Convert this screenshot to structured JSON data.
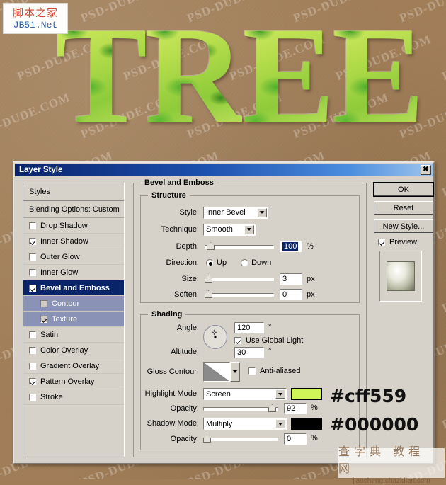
{
  "artwork": {
    "word_letters": [
      "T",
      "R",
      "E",
      "E"
    ],
    "background_color": "#a07d57",
    "watermark_text": "PSD-DUDE.COM"
  },
  "logo": {
    "cn": "脚本之家",
    "en": "JB51.Net"
  },
  "footer_watermark": {
    "cn": "查字典 教程 网",
    "url": "jiaocheng.chazidian.com"
  },
  "dialog": {
    "title": "Layer Style",
    "close_label": "✖"
  },
  "styles_panel": {
    "header": "Styles",
    "blending_options": "Blending Options: Custom",
    "effects": [
      {
        "label": "Drop Shadow",
        "checked": false,
        "selected": false,
        "indent": false
      },
      {
        "label": "Inner Shadow",
        "checked": true,
        "selected": false,
        "indent": false
      },
      {
        "label": "Outer Glow",
        "checked": false,
        "selected": false,
        "indent": false
      },
      {
        "label": "Inner Glow",
        "checked": false,
        "selected": false,
        "indent": false
      },
      {
        "label": "Bevel and Emboss",
        "checked": true,
        "selected": true,
        "indent": false
      },
      {
        "label": "Contour",
        "checked": false,
        "selected": "sub",
        "indent": true
      },
      {
        "label": "Texture",
        "checked": true,
        "selected": "sub",
        "indent": true
      },
      {
        "label": "Satin",
        "checked": false,
        "selected": false,
        "indent": false
      },
      {
        "label": "Color Overlay",
        "checked": false,
        "selected": false,
        "indent": false
      },
      {
        "label": "Gradient Overlay",
        "checked": false,
        "selected": false,
        "indent": false
      },
      {
        "label": "Pattern Overlay",
        "checked": true,
        "selected": false,
        "indent": false
      },
      {
        "label": "Stroke",
        "checked": false,
        "selected": false,
        "indent": false
      }
    ]
  },
  "bevel": {
    "group_title": "Bevel and Emboss",
    "structure": {
      "title": "Structure",
      "style_label": "Style:",
      "style_value": "Inner Bevel",
      "technique_label": "Technique:",
      "technique_value": "Smooth",
      "depth_label": "Depth:",
      "depth_value": "100",
      "depth_unit": "%",
      "direction_label": "Direction:",
      "direction_up": "Up",
      "direction_down": "Down",
      "direction_selected": "Up",
      "size_label": "Size:",
      "size_value": "3",
      "size_unit": "px",
      "soften_label": "Soften:",
      "soften_value": "0",
      "soften_unit": "px"
    },
    "shading": {
      "title": "Shading",
      "angle_label": "Angle:",
      "angle_value": "120",
      "degree_symbol": "°",
      "use_global_light": "Use Global Light",
      "use_global_light_checked": true,
      "altitude_label": "Altitude:",
      "altitude_value": "30",
      "gloss_contour_label": "Gloss Contour:",
      "anti_aliased_label": "Anti-aliased",
      "anti_aliased_checked": false,
      "highlight_mode_label": "Highlight Mode:",
      "highlight_mode_value": "Screen",
      "highlight_color": "#cff559",
      "highlight_opacity_label": "Opacity:",
      "highlight_opacity_value": "92",
      "highlight_opacity_unit": "%",
      "shadow_mode_label": "Shadow Mode:",
      "shadow_mode_value": "Multiply",
      "shadow_color": "#000000",
      "shadow_opacity_label": "Opacity:",
      "shadow_opacity_value": "0",
      "shadow_opacity_unit": "%"
    }
  },
  "buttons": {
    "ok": "OK",
    "reset": "Reset",
    "new_style": "New Style...",
    "preview": "Preview",
    "preview_checked": true
  },
  "annotations": {
    "highlight_hex": "#cff559",
    "shadow_hex": "#000000"
  }
}
